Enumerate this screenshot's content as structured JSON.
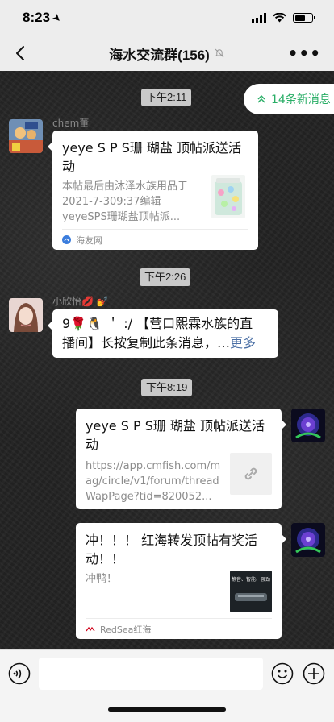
{
  "status": {
    "time": "8:23"
  },
  "nav": {
    "title": "海水交流群(156)"
  },
  "new_messages": {
    "label": "14条新消息"
  },
  "messages": [
    {
      "time": "下午2:11",
      "sender": "chem董",
      "title": "yeye S P S珊 瑚盐 顶帖派送活动",
      "desc": "本帖最后由沐泽水族用品于2021-7-309:37编辑yeyeSPS珊瑚盐顶帖派...",
      "source": "海友网"
    },
    {
      "time": "下午2:26",
      "sender": "小欣怡💋 💅",
      "text_line1": "9🌹🐧  ＇ :/ 【营口熙霖水族的直",
      "text_line2": "播间】长按复制此条消息，…",
      "more": "更多"
    },
    {
      "time": "下午8:19",
      "title": "yeye S P S珊 瑚盐 顶帖派送活动",
      "desc": "https://app.cmfish.com/mag/circle/v1/forum/threadWapPage?tid=820052..."
    },
    {
      "title": "冲！！！ 红海转发顶帖有奖活动！！",
      "desc": "冲鸭！",
      "thumb_text": "静音、智能、强劲",
      "source": "RedSea红海"
    }
  ],
  "colors": {
    "accent": "#2aae67",
    "chip": "#c9c9c9",
    "link": "#4a6fa5"
  }
}
